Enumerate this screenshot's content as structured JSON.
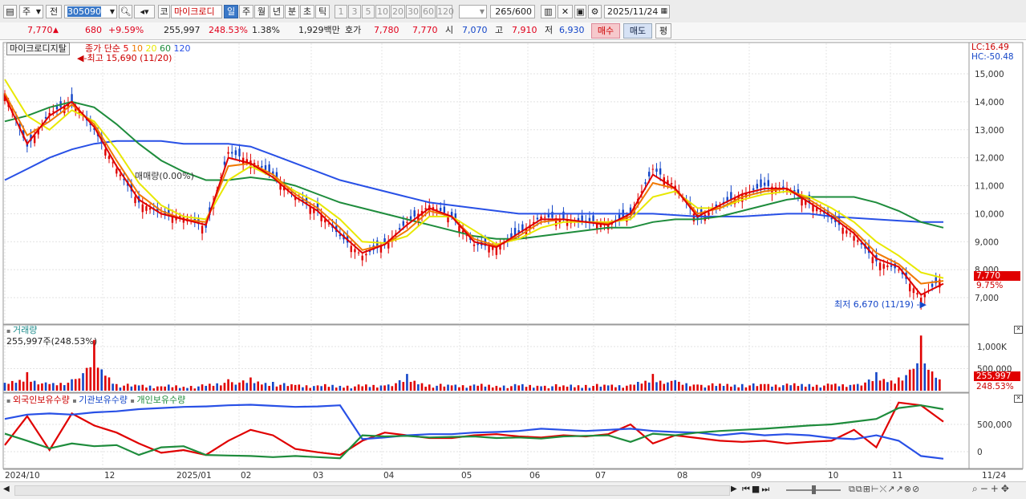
{
  "toolbar": {
    "period_code": "주",
    "prev_label": "전",
    "stock_code": "305090",
    "search_icon": "search-icon",
    "sound_icon": "speaker-icon",
    "market_label": "코",
    "stock_name": "마이크로디",
    "period_tabs": [
      "일",
      "주",
      "월",
      "년",
      "분",
      "초",
      "틱"
    ],
    "active_period": "일",
    "intervals": [
      "1",
      "3",
      "5",
      "10",
      "20",
      "30",
      "60",
      "120"
    ],
    "count": "265",
    "max_count": "/600",
    "date": "2025/11/24"
  },
  "quote": {
    "price": "7,770",
    "change": "680",
    "change_pct": "+9.59%",
    "volume": "255,997",
    "volume_ratio": "248.53%",
    "turnover_pct": "1.38%",
    "amount": "1,929백만",
    "bid_label": "호가",
    "bid": "7,780",
    "ask": "7,770",
    "open_label": "시",
    "open": "7,070",
    "high_label": "고",
    "high": "7,910",
    "low_label": "저",
    "low": "6,930",
    "buy_label": "매수",
    "sell_label": "매도",
    "eval_label": "평"
  },
  "price_panel": {
    "stock_label": "마이크로디지탈",
    "ma_label": "종가 단순",
    "ma_periods": [
      "5",
      "10",
      "20",
      "60",
      "120"
    ],
    "ma_colors": [
      "#e00000",
      "#f07800",
      "#e8e800",
      "#1e8c3c",
      "#2850e6"
    ],
    "lc": "LC:16.49",
    "hc": "HC:-50.48",
    "high_marker": "최고 15,690 (11/20)",
    "low_marker": "최저 6,670 (11/19)",
    "trade_marker": "매매량(0.00%)",
    "last_price_tag": "7,770",
    "last_pct_tag": "9.75%",
    "y_ticks": [
      "15,000",
      "14,000",
      "13,000",
      "12,000",
      "11,000",
      "10,000",
      "9,000",
      "8,000",
      "7,000"
    ]
  },
  "volume_panel": {
    "title": "거래량",
    "value": "255,997주(248.53%)",
    "y_ticks": [
      "1,000K",
      "500,000"
    ],
    "last_tag": "255,997",
    "last_pct": "248.53%"
  },
  "holding_panel": {
    "series": [
      "외국인보유수량",
      "기관보유수량",
      "개인보유수량"
    ],
    "series_colors": [
      "#e00000",
      "#2850e6",
      "#1e8c3c"
    ],
    "y_ticks": [
      "500,000",
      "0"
    ]
  },
  "x_axis": [
    "2024/10",
    "12",
    "2025/01",
    "02",
    "03",
    "04",
    "05",
    "06",
    "07",
    "08",
    "09",
    "10",
    "11",
    "11/24"
  ],
  "chart_data": {
    "type": "line",
    "x_labels": [
      "2024/10",
      "12",
      "2025/01",
      "02",
      "03",
      "04",
      "05",
      "06",
      "07",
      "08",
      "09",
      "10",
      "11",
      "11/24"
    ],
    "price_range": [
      6500,
      16000
    ],
    "price_ticks": [
      15000,
      14000,
      13000,
      12000,
      11000,
      10000,
      9000,
      8000,
      7000
    ],
    "close": [
      14300,
      12400,
      13600,
      14000,
      13000,
      11600,
      10400,
      10000,
      9900,
      9500,
      12200,
      11900,
      11400,
      10600,
      10100,
      9200,
      8500,
      8900,
      9700,
      10300,
      9900,
      8900,
      8800,
      9300,
      9900,
      9800,
      9700,
      9600,
      10000,
      11600,
      11000,
      9800,
      10300,
      10700,
      11000,
      10900,
      10400,
      9800,
      9200,
      8300,
      8000,
      7000,
      7770
    ],
    "series": [
      {
        "name": "5",
        "values": [
          14200,
          12500,
          13500,
          14000,
          13100,
          11700,
          10500,
          10000,
          9800,
          9600,
          12000,
          11800,
          11300,
          10600,
          10100,
          9300,
          8600,
          8900,
          9600,
          10200,
          9900,
          9000,
          8800,
          9300,
          9800,
          9800,
          9700,
          9600,
          10000,
          11400,
          10900,
          9900,
          10300,
          10700,
          10900,
          10900,
          10400,
          9900,
          9300,
          8400,
          8100,
          7100,
          7500
        ]
      },
      {
        "name": "10",
        "values": [
          14300,
          12800,
          13300,
          13900,
          13200,
          11900,
          10700,
          10100,
          9800,
          9700,
          11700,
          11800,
          11400,
          10700,
          10200,
          9500,
          8700,
          8900,
          9400,
          10100,
          9900,
          9100,
          8850,
          9200,
          9700,
          9800,
          9700,
          9650,
          9900,
          11100,
          10900,
          10000,
          10200,
          10600,
          10800,
          10900,
          10500,
          10000,
          9400,
          8600,
          8200,
          7500,
          7600
        ]
      },
      {
        "name": "20",
        "values": [
          14800,
          13500,
          13000,
          13700,
          13300,
          12300,
          11100,
          10300,
          9900,
          9800,
          11200,
          11700,
          11300,
          10800,
          10400,
          9800,
          9000,
          8950,
          9200,
          9900,
          9900,
          9400,
          8900,
          9100,
          9500,
          9700,
          9700,
          9700,
          9800,
          10600,
          10800,
          10200,
          10200,
          10500,
          10700,
          10800,
          10600,
          10200,
          9700,
          9000,
          8500,
          7900,
          7700
        ]
      },
      {
        "name": "60",
        "values": [
          13300,
          13500,
          13800,
          14000,
          13800,
          13200,
          12500,
          11900,
          11500,
          11200,
          11200,
          11300,
          11200,
          11000,
          10700,
          10400,
          10200,
          10000,
          9800,
          9600,
          9400,
          9200,
          9100,
          9100,
          9200,
          9300,
          9400,
          9500,
          9500,
          9700,
          9800,
          9800,
          9900,
          10100,
          10300,
          10500,
          10600,
          10600,
          10600,
          10400,
          10100,
          9700,
          9500
        ]
      },
      {
        "name": "120",
        "values": [
          11200,
          11600,
          12000,
          12300,
          12500,
          12600,
          12600,
          12600,
          12500,
          12500,
          12500,
          12400,
          12100,
          11800,
          11500,
          11200,
          11000,
          10800,
          10600,
          10400,
          10300,
          10200,
          10100,
          10000,
          10000,
          10000,
          10000,
          10000,
          10000,
          10000,
          9950,
          9900,
          9900,
          9900,
          9950,
          10000,
          10000,
          9900,
          9850,
          9800,
          9750,
          9700,
          9700
        ]
      }
    ],
    "volume_k": [
      180,
      420,
      150,
      260,
      1150,
      150,
      120,
      100,
      90,
      110,
      260,
      300,
      200,
      130,
      120,
      110,
      100,
      120,
      380,
      140,
      120,
      140,
      110,
      120,
      100,
      120,
      130,
      120,
      140,
      380,
      240,
      140,
      160,
      150,
      150,
      160,
      150,
      140,
      140,
      420,
      300,
      1250,
      256
    ],
    "holdings_k": {
      "외국인보유수량": [
        120,
        650,
        30,
        700,
        480,
        350,
        150,
        -20,
        30,
        -60,
        200,
        400,
        300,
        50,
        -10,
        -60,
        200,
        350,
        300,
        250,
        250,
        300,
        320,
        280,
        260,
        300,
        280,
        320,
        500,
        150,
        300,
        250,
        200,
        180,
        200,
        150,
        180,
        200,
        400,
        80,
        900,
        850,
        550
      ],
      "기관보유수량": [
        600,
        680,
        700,
        680,
        720,
        740,
        780,
        800,
        820,
        830,
        850,
        860,
        840,
        820,
        830,
        850,
        230,
        260,
        300,
        320,
        320,
        350,
        360,
        380,
        420,
        400,
        380,
        400,
        420,
        380,
        360,
        350,
        300,
        340,
        300,
        320,
        300,
        250,
        230,
        300,
        200,
        -80,
        -130
      ],
      "개인보유수량": [
        330,
        200,
        60,
        150,
        100,
        120,
        -60,
        80,
        100,
        -60,
        -70,
        -80,
        -100,
        -80,
        -100,
        -120,
        300,
        280,
        290,
        260,
        270,
        280,
        250,
        260,
        240,
        280,
        290,
        300,
        180,
        330,
        300,
        350,
        380,
        400,
        420,
        450,
        480,
        500,
        550,
        600,
        800,
        850,
        780
      ]
    }
  }
}
